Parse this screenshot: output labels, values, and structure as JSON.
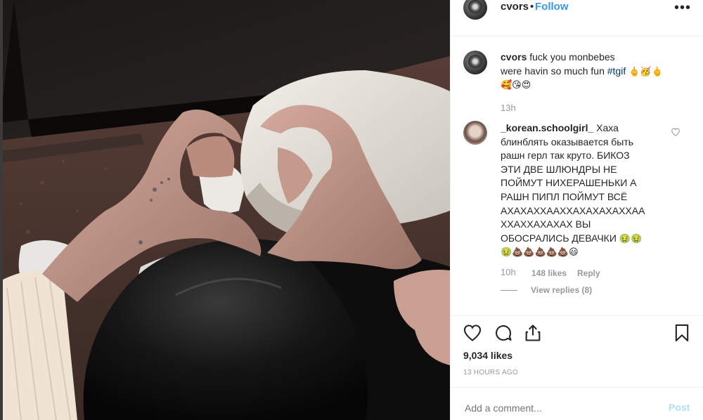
{
  "post": {
    "author": "cvors",
    "separator": "•",
    "follow_label": "Follow",
    "more_icon": "more-dots-icon",
    "caption": {
      "username": "cvors",
      "line1": "fuck you monbebes",
      "line2_text": "were havin so much fun",
      "hashtag": "#tgif",
      "emojis_line2": "🖕🥳🖕",
      "emojis_line3": "🥰😘😍",
      "time": "13h"
    },
    "comment": {
      "username": "_korean.schoolgirl_",
      "lines": [
        "Хаха",
        "блинблять оказывается быть",
        "рашн герл так круто. БИКОЗ",
        "ЭТИ ДВЕ ШЛЮНДРЫ НЕ",
        "ПОЙМУТ НИХЕРАШЕНЬКИ А",
        "РАШН ПИПЛ ПОЙМУТ ВСЁ",
        "АХАХАХХААХХАХАХАХАХХАА",
        "ХХАХХАХАХАХ ВЫ",
        "ОБОСРАЛИСЬ ДЕВАЧКИ"
      ],
      "emojis_a": "🤢🤢",
      "emojis_b": "🤢💩💩💩💩💩😃",
      "time": "10h",
      "likes": "148 likes",
      "reply_label": "Reply",
      "view_replies": "View replies (8)"
    },
    "likes_count": "9,034 likes",
    "time_ago": "13 HOURS AGO",
    "add_comment_placeholder": "Add a comment...",
    "post_label": "Post"
  }
}
